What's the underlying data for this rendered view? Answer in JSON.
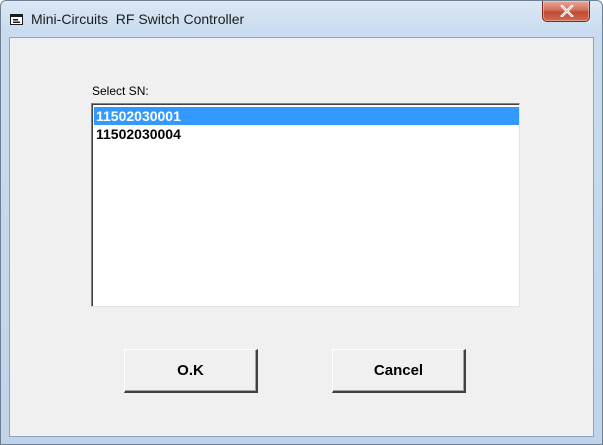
{
  "window": {
    "title": "Mini-Circuits  RF Switch Controller",
    "icon": "app-window-icon",
    "close_icon": "close-icon"
  },
  "dialog": {
    "select_label": "Select SN:",
    "serial_numbers": [
      {
        "label": "11502030001",
        "selected": true
      },
      {
        "label": "11502030004",
        "selected": false
      }
    ],
    "ok_label": "O.K",
    "cancel_label": "Cancel"
  },
  "colors": {
    "selection": "#3399ff",
    "close_button": "#c24a33",
    "frame": "#c9dcef"
  }
}
